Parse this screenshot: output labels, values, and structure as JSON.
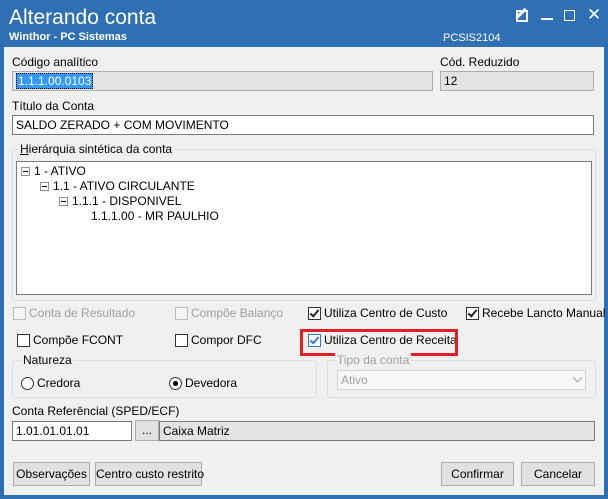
{
  "window": {
    "title": "Alterando conta",
    "subtitle": "Winthor - PC Sistemas",
    "code": "PCSIS2104"
  },
  "fields": {
    "codigo_analitico_label": "Código analítico",
    "codigo_analitico_value": "1.1.1.00.0103",
    "cod_reduzido_label": "Cód. Reduzido",
    "cod_reduzido_value": "12",
    "titulo_label": "Título da Conta",
    "titulo_value": "SALDO ZERADO + COM MOVIMENTO"
  },
  "hierarchy": {
    "title": "Hierárquia sintética da conta",
    "nodes": [
      {
        "label": "1 - ATIVO"
      },
      {
        "label": "1.1 - ATIVO CIRCULANTE"
      },
      {
        "label": "1.1.1 - DISPONIVEL"
      },
      {
        "label": "1.1.1.00 - MR PAULHIO"
      }
    ]
  },
  "checkboxes": {
    "conta_resultado": {
      "label": "Conta de Resultado",
      "checked": false,
      "enabled": false
    },
    "compoe_balanco": {
      "label": "Compõe Balanço",
      "checked": false,
      "enabled": false
    },
    "utiliza_centro_custo": {
      "label": "Utiliza Centro de Custo",
      "checked": true,
      "enabled": true
    },
    "recebe_lancto_manual": {
      "label": "Recebe Lancto Manual",
      "checked": true,
      "enabled": true
    },
    "compoe_fcont": {
      "label": "Compõe FCONT",
      "checked": false,
      "enabled": true
    },
    "compor_dfc": {
      "label": "Compor DFC",
      "checked": false,
      "enabled": true
    },
    "utiliza_centro_receita": {
      "label": "Utiliza Centro de Receita",
      "checked": true,
      "enabled": true
    }
  },
  "natureza": {
    "title": "Natureza",
    "options": [
      {
        "label": "Credora",
        "selected": false
      },
      {
        "label": "Devedora",
        "selected": true
      }
    ]
  },
  "tipo_conta": {
    "title": "Tipo da conta",
    "value": "Ativo"
  },
  "referencial": {
    "label": "Conta Referêncial (SPED/ECF)",
    "code": "1.01.01.01.01",
    "browse": "...",
    "description": "Caixa Matriz"
  },
  "buttons": {
    "observacoes": "Observações",
    "centro_custo": "Centro custo restrito",
    "confirmar": "Confirmar",
    "cancelar": "Cancelar"
  },
  "colors": {
    "titlebar": "#2f6fb3",
    "highlight": "#e31e24",
    "selection": "#3399ff"
  }
}
